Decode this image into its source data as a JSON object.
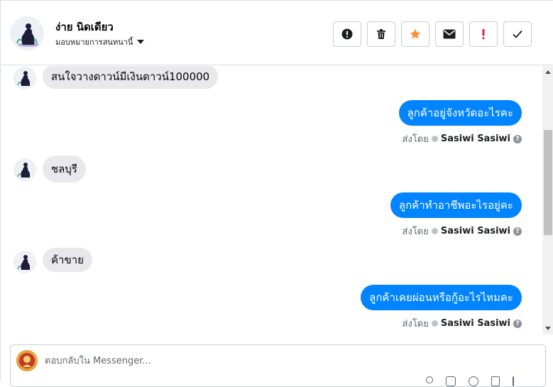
{
  "header": {
    "contact_name": "ง่าย นิดเดียว",
    "assign_label": "มอบหมายการสนทนานี้",
    "toolbar": [
      {
        "name": "mark-spam-button",
        "icon": "exclamation-circle-icon"
      },
      {
        "name": "delete-button",
        "icon": "trash-icon"
      },
      {
        "name": "star-button",
        "icon": "star-icon",
        "color": "#f7923a"
      },
      {
        "name": "mark-unread-button",
        "icon": "envelope-icon"
      },
      {
        "name": "follow-up-button",
        "icon": "exclamation-icon",
        "color": "#e41e3f"
      },
      {
        "name": "mark-done-button",
        "icon": "checkmark-icon"
      }
    ]
  },
  "messages": [
    {
      "dir": "in",
      "text": "สนใจวางดาวน์มีเงินดาวน์100000"
    },
    {
      "dir": "out",
      "text": "ลูกค้าอยู่จังหวัดอะไรคะ",
      "sent_by_prefix": "ส่งโดย",
      "sender": "Sasiwi Sasiwi"
    },
    {
      "dir": "in",
      "text": "ชลบุรี"
    },
    {
      "dir": "out",
      "text": "ลูกค้าทำอาชีพอะไรอยู่คะ",
      "sent_by_prefix": "ส่งโดย",
      "sender": "Sasiwi Sasiwi"
    },
    {
      "dir": "in",
      "text": "ค้าขาย"
    },
    {
      "dir": "out",
      "text": "ลูกค้าเคยผ่อนหรือกู้อะไรไหมคะ",
      "sent_by_prefix": "ส่งโดย",
      "sender": "Sasiwi Sasiwi"
    }
  ],
  "composer": {
    "placeholder": "ตอบกลับใน Messenger..."
  },
  "colors": {
    "accent": "#0084ff",
    "incoming_bubble": "#e9e9eb",
    "star": "#f7923a",
    "alert": "#e41e3f"
  }
}
